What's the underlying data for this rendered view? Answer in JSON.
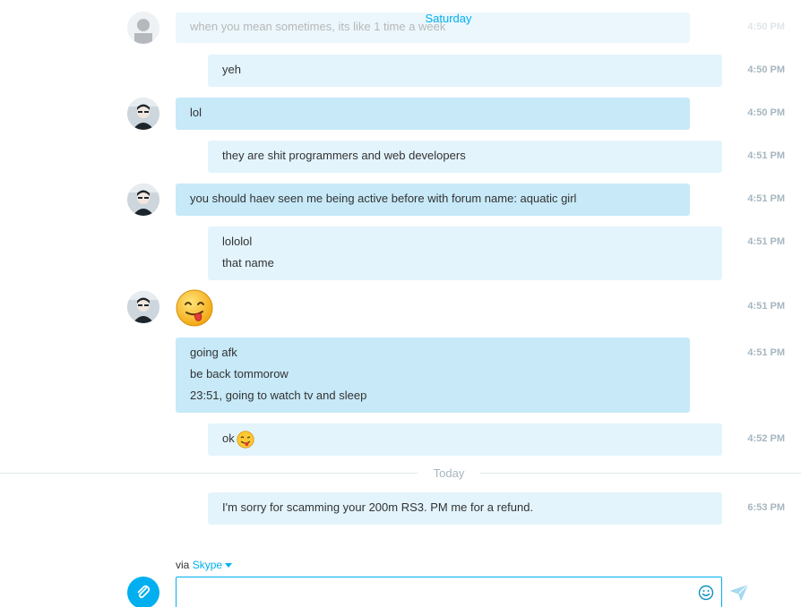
{
  "conversation": {
    "day_label_top": "Saturday",
    "partial": {
      "text": "when you mean sometimes, its like 1 time a week",
      "time": "4:50 PM"
    },
    "messages": {
      "m1": {
        "lines": [
          "yeh"
        ],
        "time": "4:50 PM",
        "sender": "me"
      },
      "m2": {
        "lines": [
          "lol"
        ],
        "time": "4:50 PM",
        "sender": "contact"
      },
      "m3": {
        "lines": [
          "they are shit programmers and web developers"
        ],
        "time": "4:51 PM",
        "sender": "me"
      },
      "m4": {
        "lines": [
          "you should haev seen me being active before with forum name: aquatic girl"
        ],
        "time": "4:51 PM",
        "sender": "contact"
      },
      "m5": {
        "lines": [
          "lololol",
          "that name"
        ],
        "time": "4:51 PM",
        "sender": "me"
      },
      "m6": {
        "emoji": "tongue-out-face-emoji",
        "time": "4:51 PM",
        "sender": "contact"
      },
      "m7": {
        "lines": [
          "going afk",
          "be back tommorow",
          "23:51, going to watch tv and sleep"
        ],
        "time": "4:51 PM",
        "sender": "contact"
      },
      "m8": {
        "lines": [
          "ok"
        ],
        "emoji": "winking-tongue-emoji",
        "time": "4:52 PM",
        "sender": "me"
      },
      "m9": {
        "lines": [
          "I'm sorry for scamming your 200m RS3. PM me for a refund."
        ],
        "time": "6:53 PM",
        "sender": "me"
      }
    },
    "divider_label": "Today"
  },
  "composer": {
    "via_prefix": "via",
    "via_service": "Skype",
    "input_value": "",
    "icons": {
      "attach": "paperclip-icon",
      "emoji": "smiley-icon",
      "send": "send-icon",
      "service_dropdown": "chevron-down-icon"
    }
  },
  "colors": {
    "accent": "#00aff0",
    "incoming_bubble": "#c7e9f8",
    "outgoing_bubble": "#e3f4fc",
    "timestamp": "#a6b6bf"
  }
}
